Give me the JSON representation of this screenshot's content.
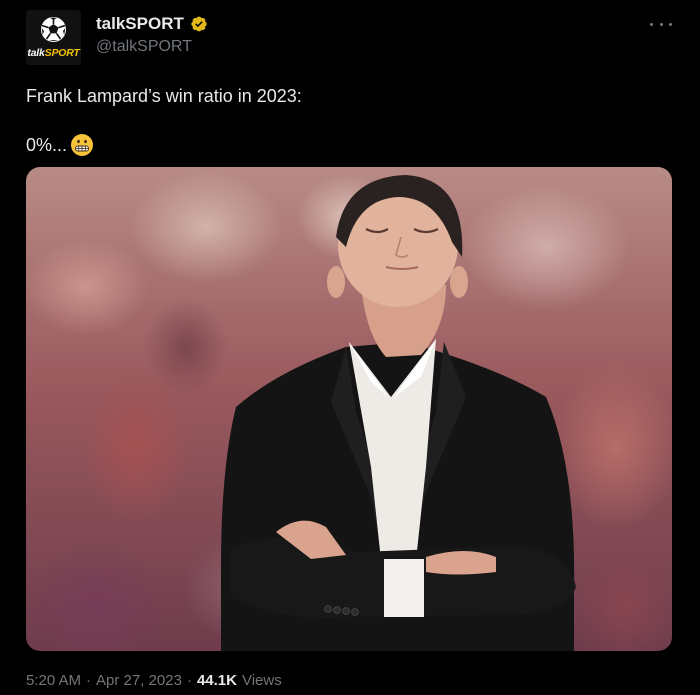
{
  "tweet": {
    "author": {
      "display_name": "talkSPORT",
      "handle": "@talkSPORT",
      "verified_icon": "verified-gold-badge",
      "avatar": {
        "brand_part1": "talk",
        "brand_part2": "SPORT",
        "icon": "football-icon"
      }
    },
    "more_icon": "more-horizontal-icon",
    "text_line1": "Frank Lampard’s win ratio in 2023:",
    "text_line2": "0%...",
    "emoji": "grimacing-face-emoji",
    "media_description_icon": "photo",
    "meta": {
      "time": "5:20 AM",
      "separator": "·",
      "date": "Apr 27, 2023",
      "views_count": "44.1K",
      "views_label": "Views"
    }
  },
  "colors": {
    "background": "#000000",
    "text": "#e7e9ea",
    "secondary_text": "#71767b",
    "verified_gold": "#e2b719"
  }
}
